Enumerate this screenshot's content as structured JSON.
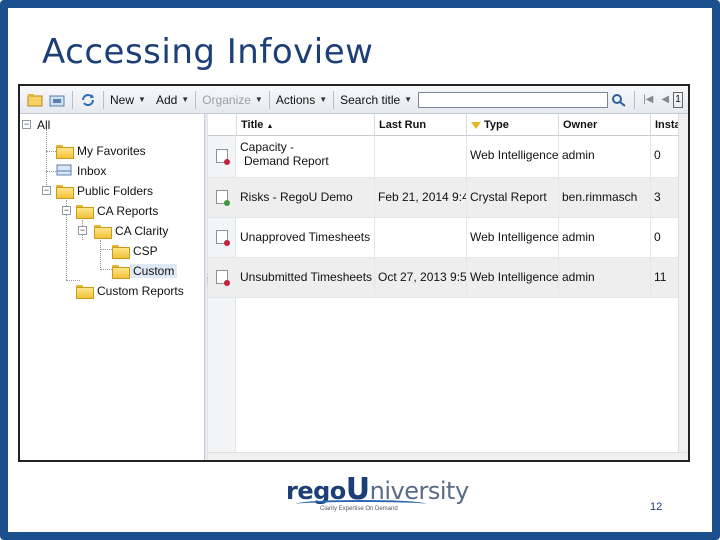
{
  "slide": {
    "title": "Accessing Infoview",
    "page_number": "12",
    "logo": {
      "brand_part1": "rego",
      "brand_part2": "U",
      "brand_part3": "niversity",
      "tagline": "Clarity Expertise On Demand"
    },
    "colors": {
      "frame": "#1c4f8e",
      "title": "#1c3f78"
    }
  },
  "toolbar": {
    "new_label": "New",
    "add_label": "Add",
    "organize_label": "Organize",
    "actions_label": "Actions",
    "search_mode_label": "Search title",
    "search_value": "",
    "page_input": "1"
  },
  "tree": {
    "root": "All",
    "my_favorites": "My Favorites",
    "inbox": "Inbox",
    "public_folders": "Public Folders",
    "ca_reports": "CA Reports",
    "ca_clarity": "CA Clarity",
    "csp": "CSP",
    "custom": "Custom",
    "custom_reports": "Custom Reports"
  },
  "list": {
    "columns": {
      "title": "Title",
      "last_run": "Last Run",
      "type": "Type",
      "owner": "Owner",
      "instances": "Insta"
    },
    "rows": [
      {
        "title_line1": "Capacity -",
        "title_line2": "Demand Report",
        "last_run": "",
        "type": "Web Intelligence",
        "owner": "admin",
        "instances": "0",
        "icon": "webi-document-icon"
      },
      {
        "title_line1": "Risks - RegoU Demo",
        "title_line2": "",
        "last_run": "Feb 21, 2014 9:4",
        "type": "Crystal Report",
        "owner": "ben.rimmasch",
        "instances": "3",
        "icon": "crystal-report-icon"
      },
      {
        "title_line1": "Unapproved Timesheets",
        "title_line2": "",
        "last_run": "",
        "type": "Web Intelligence",
        "owner": "admin",
        "instances": "0",
        "icon": "webi-document-icon"
      },
      {
        "title_line1": "Unsubmitted Timesheets",
        "title_line2": "",
        "last_run": "Oct 27, 2013 9:5",
        "type": "Web Intelligence",
        "owner": "admin",
        "instances": "11",
        "icon": "webi-document-icon"
      }
    ]
  }
}
